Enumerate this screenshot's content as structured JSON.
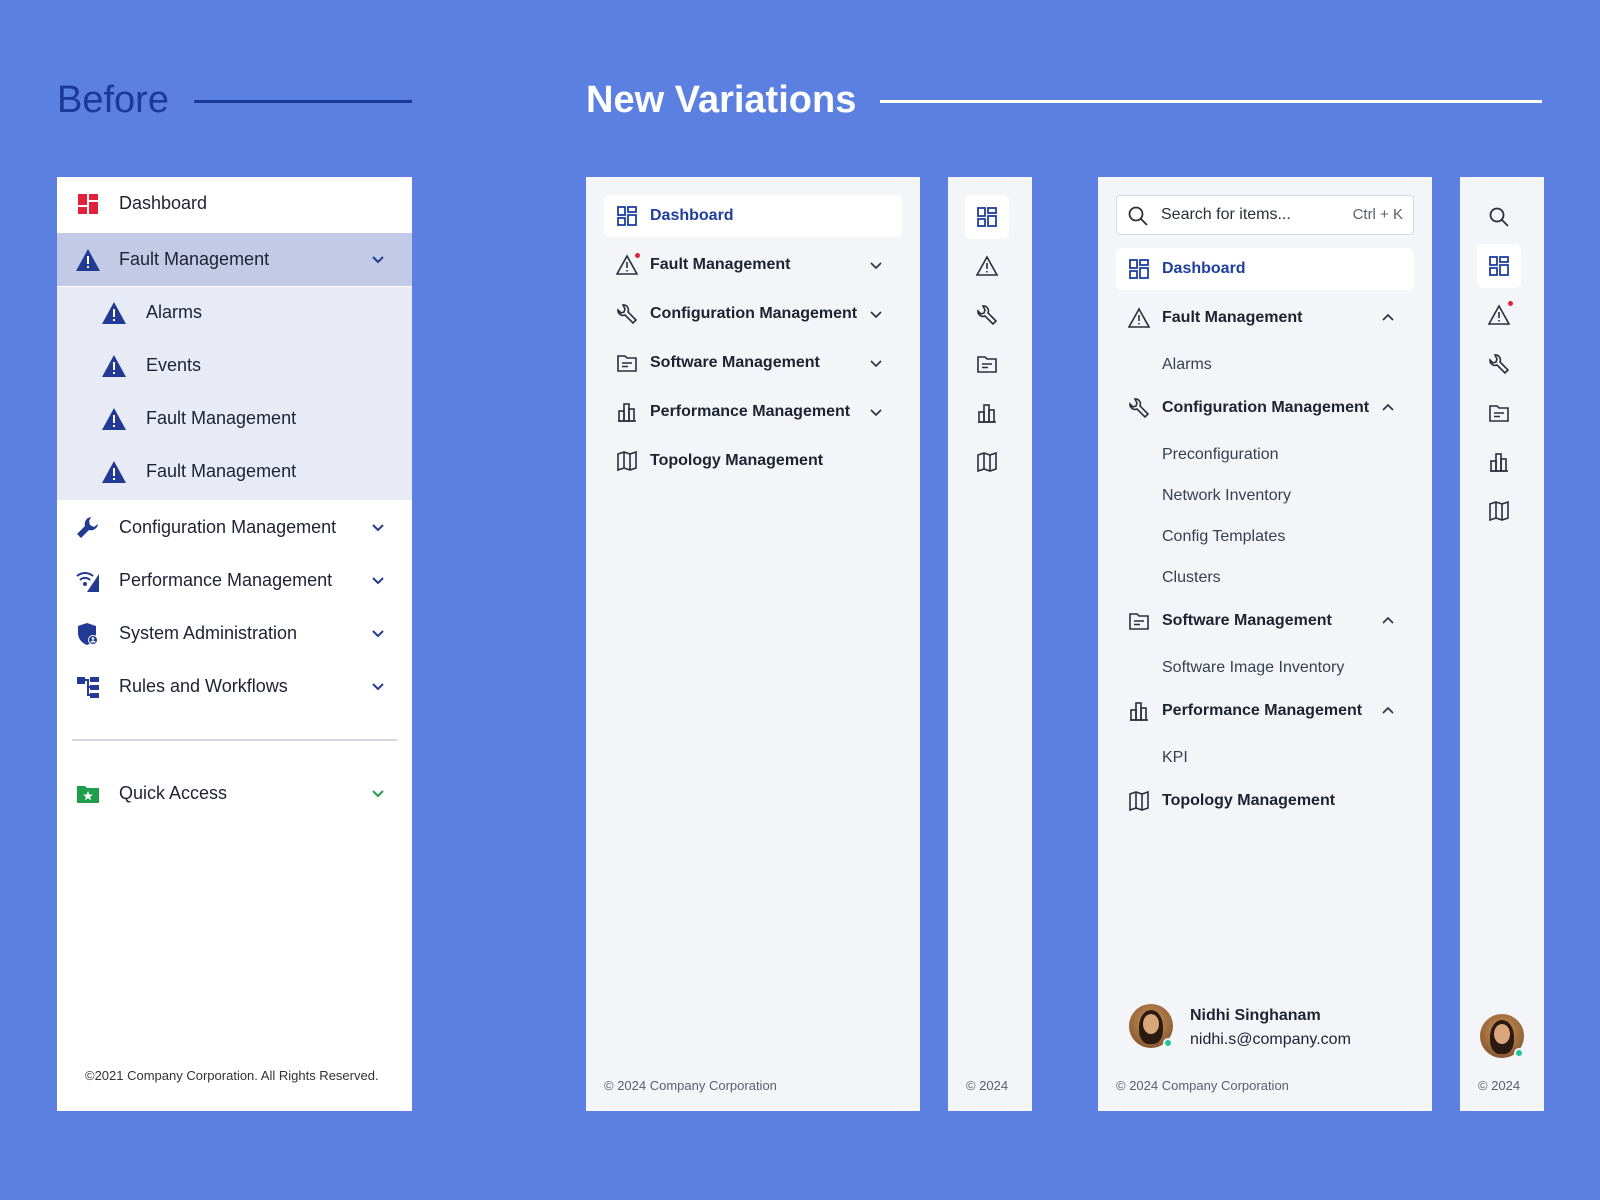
{
  "headings": {
    "before": "Before",
    "new_variations": "New Variations"
  },
  "colors": {
    "background": "#5b80e2",
    "accent": "#1f3fa0",
    "alert_dot": "#e0233b",
    "online": "#22c59a"
  },
  "before": {
    "items": [
      {
        "label": "Dashboard",
        "icon": "dashboard-icon"
      },
      {
        "label": "Fault Management",
        "icon": "warning-icon",
        "expanded": true
      },
      {
        "label": "Alarms",
        "icon": "warning-icon"
      },
      {
        "label": "Events",
        "icon": "warning-icon"
      },
      {
        "label": "Fault Management",
        "icon": "warning-icon"
      },
      {
        "label": "Fault Management",
        "icon": "warning-icon"
      },
      {
        "label": "Configuration Management",
        "icon": "wrench-icon"
      },
      {
        "label": "Performance Management",
        "icon": "signal-icon"
      },
      {
        "label": "System Administration",
        "icon": "shield-user-icon"
      },
      {
        "label": "Rules and Workflows",
        "icon": "workflow-icon"
      }
    ],
    "quick_access": {
      "label": "Quick Access",
      "icon": "folder-star-icon"
    },
    "footer": "©2021 Company Corporation. All Rights Reserved."
  },
  "variation1": {
    "items": [
      {
        "label": "Dashboard",
        "icon": "grid-icon",
        "active": true
      },
      {
        "label": "Fault Management",
        "icon": "warning-icon"
      },
      {
        "label": "Configuration Management",
        "icon": "wrench-icon"
      },
      {
        "label": "Software Management",
        "icon": "folder-icon"
      },
      {
        "label": "Performance Management",
        "icon": "bar-chart-icon"
      },
      {
        "label": "Topology Management",
        "icon": "map-icon"
      }
    ],
    "footer": "© 2024 Company Corporation"
  },
  "variation1_rail": {
    "footer": "© 2024"
  },
  "variation2": {
    "search": {
      "placeholder": "Search for items...",
      "shortcut": "Ctrl + K"
    },
    "items": [
      {
        "label": "Dashboard",
        "icon": "grid-icon",
        "active": true
      },
      {
        "label": "Fault Management",
        "icon": "warning-icon",
        "children": [
          "Alarms"
        ]
      },
      {
        "label": "Configuration Management",
        "icon": "wrench-icon",
        "children": [
          "Preconfiguration",
          "Network Inventory",
          "Config Templates",
          "Clusters"
        ]
      },
      {
        "label": "Software Management",
        "icon": "folder-icon",
        "children": [
          "Software Image Inventory"
        ]
      },
      {
        "label": "Performance Management",
        "icon": "bar-chart-icon",
        "children": [
          "KPI"
        ]
      },
      {
        "label": "Topology Management",
        "icon": "map-icon"
      }
    ],
    "user": {
      "name": "Nidhi Singhanam",
      "email": "nidhi.s@company.com"
    },
    "footer": "© 2024 Company Corporation"
  },
  "variation2_rail": {
    "footer": "© 2024"
  }
}
